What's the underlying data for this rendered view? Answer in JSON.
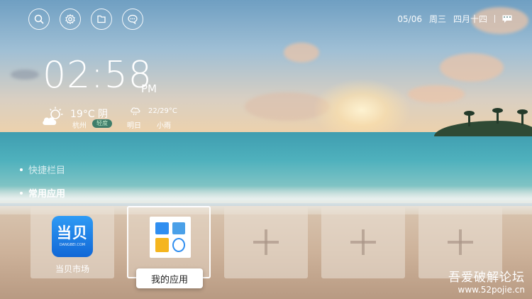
{
  "topbar": {
    "icons": [
      "search-icon",
      "settings-icon",
      "folder-icon",
      "chat-icon"
    ],
    "date": "05/06",
    "weekday": "周三",
    "lunar": "四月十四",
    "message_icon": "message-icon"
  },
  "clock": {
    "time": "02:58",
    "ampm": "PM"
  },
  "weather": {
    "icon": "partly-cloudy-icon",
    "temp": "19°C 阴",
    "city": "杭州",
    "aqi": "轻度",
    "tomorrow_icon": "rain-cloud-icon",
    "tomorrow_range": "22/29°C",
    "tomorrow_label": "明日",
    "tomorrow_desc": "小雨"
  },
  "menu": {
    "items": [
      {
        "label": "快捷栏目"
      },
      {
        "label": "常用应用"
      }
    ]
  },
  "tiles": [
    {
      "label": "当贝市场",
      "logo_text": "当贝",
      "logo_sub": "DANGBEI.COM"
    },
    {
      "label": "我的应用"
    },
    {
      "label": ""
    },
    {
      "label": ""
    },
    {
      "label": ""
    }
  ],
  "watermark": {
    "line1": "吾爱破解论坛",
    "line2": "www.52pojie.cn"
  },
  "colors": {
    "accent": "#1a7ae8",
    "aqi_badge": "#3e7d6a"
  }
}
